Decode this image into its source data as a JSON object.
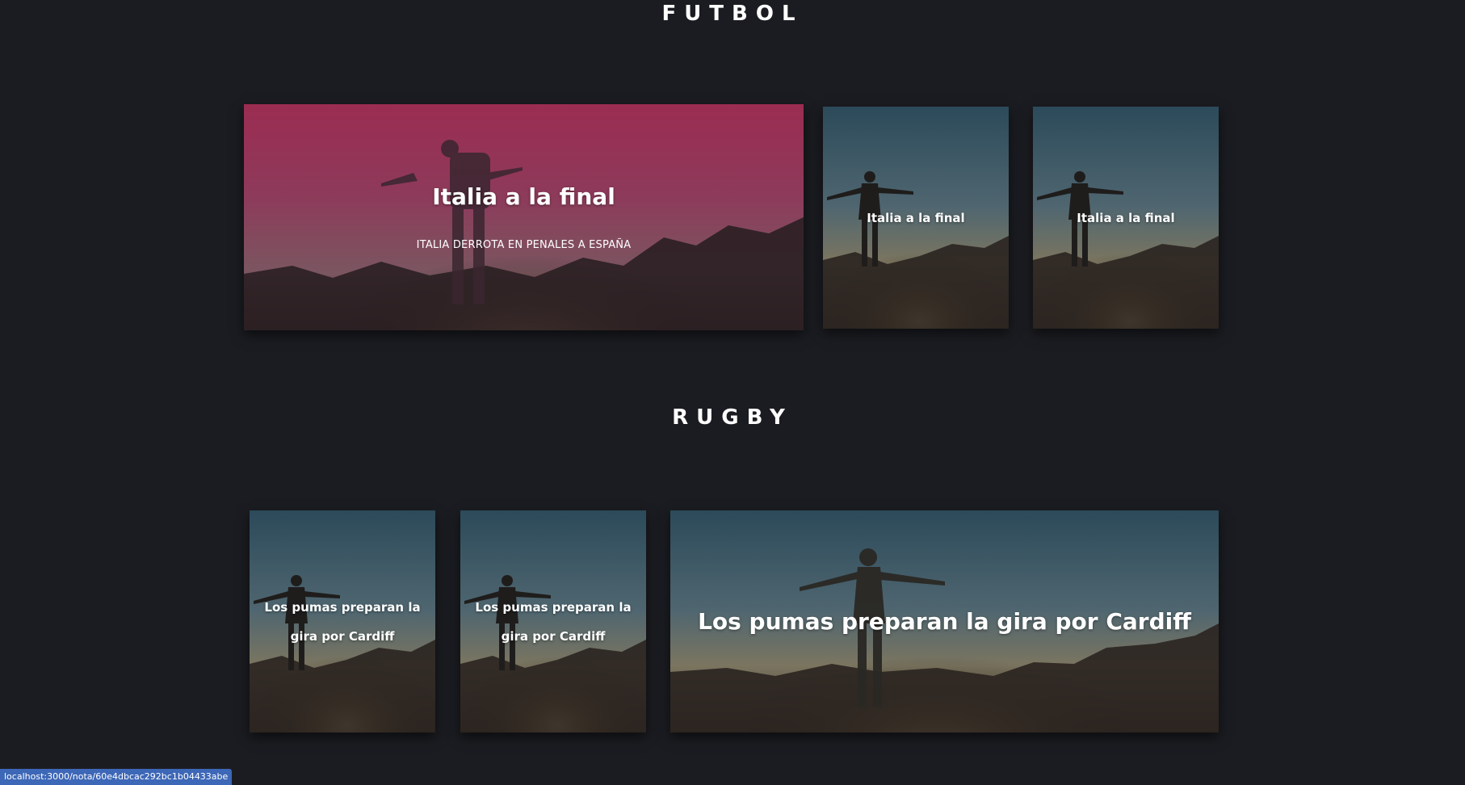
{
  "sections": {
    "futbol": {
      "title": "FUTBOL",
      "featured": {
        "title": "Italia a la final",
        "subtitle": "ITALIA DERROTA EN PENALES A ESPAÑA"
      },
      "cards": [
        {
          "title": "Italia a la final"
        },
        {
          "title": "Italia a la final"
        }
      ]
    },
    "rugby": {
      "title": "RUGBY",
      "cards": [
        {
          "title": "Los pumas preparan la gira por Cardiff"
        },
        {
          "title": "Los pumas preparan la gira por Cardiff"
        }
      ],
      "featured": {
        "title": "Los pumas preparan la gira por Cardiff"
      }
    }
  },
  "status_bar": {
    "url": "localhost:3000/nota/60e4dbcac292bc1b04433abe"
  },
  "colors": {
    "background": "#1b1c21",
    "featured_overlay": "#9e2f55",
    "status_bar": "#3d67b7"
  },
  "icons": {
    "card_image": "person-on-mountain-at-sunset"
  }
}
